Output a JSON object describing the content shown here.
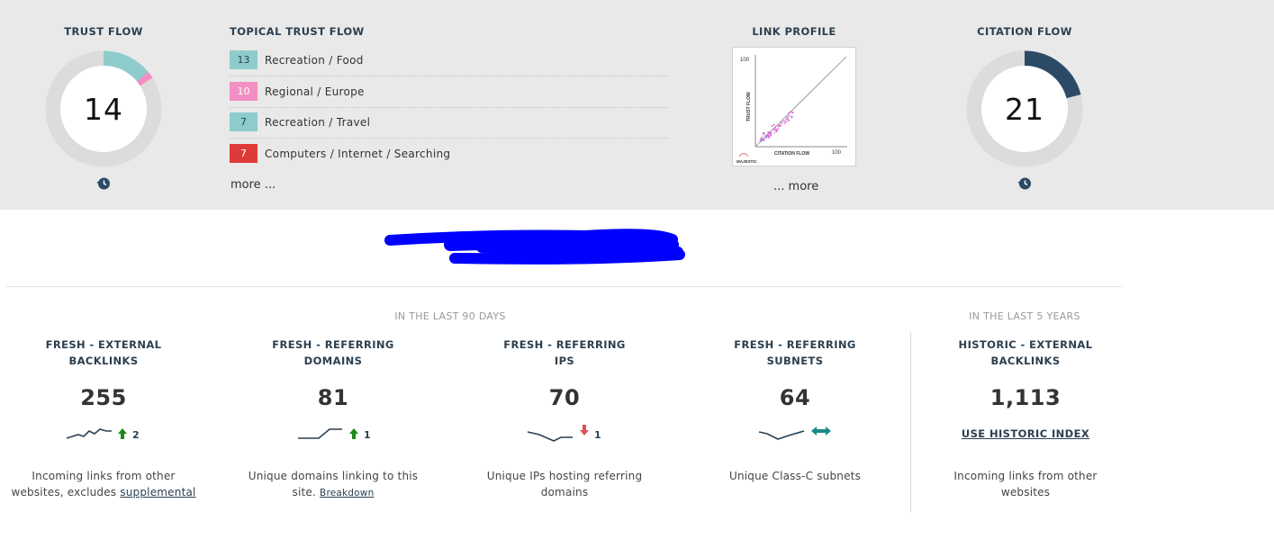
{
  "trust_flow": {
    "title": "TRUST FLOW",
    "value": "14",
    "fill_fraction": 0.14,
    "accent_fraction": 0.02
  },
  "topical_trust_flow": {
    "title": "TOPICAL TRUST FLOW",
    "items": [
      {
        "score": "13",
        "label": "Recreation / Food",
        "color": "#8ecccc"
      },
      {
        "score": "10",
        "label": "Regional / Europe",
        "color": "#f48fc3"
      },
      {
        "score": "7",
        "label": "Recreation / Travel",
        "color": "#8ecccc"
      },
      {
        "score": "7",
        "label": "Computers / Internet / Searching",
        "color": "#de3a3a"
      }
    ],
    "more": "more ..."
  },
  "link_profile": {
    "title": "LINK PROFILE",
    "y_axis_label": "TRUST FLOW",
    "x_axis_label": "CITATION FLOW",
    "y_max_label": "100",
    "x_max_label": "100",
    "brand": "MAJESTIC",
    "more": "... more"
  },
  "citation_flow": {
    "title": "CITATION FLOW",
    "value": "21",
    "fill_fraction": 0.21
  },
  "periods": {
    "recent": "IN THE LAST 90 DAYS",
    "historic": "IN THE LAST 5 YEARS"
  },
  "stats": [
    {
      "title_line1": "FRESH - EXTERNAL",
      "title_line2": "BACKLINKS",
      "value": "255",
      "change": "2",
      "direction": "up",
      "desc_line1": "Incoming links from other",
      "desc_line2": "websites, excludes ",
      "desc_link": "supplemental"
    },
    {
      "title_line1": "FRESH - REFERRING",
      "title_line2": "DOMAINS",
      "value": "81",
      "change": "1",
      "direction": "up",
      "desc_line1": "Unique domains linking to this",
      "desc_line2": "site. ",
      "desc_link": "Breakdown"
    },
    {
      "title_line1": "FRESH - REFERRING",
      "title_line2": "IPS",
      "value": "70",
      "change": "1",
      "direction": "down",
      "desc_line1": "Unique IPs hosting referring",
      "desc_line2": "domains",
      "desc_link": ""
    },
    {
      "title_line1": "FRESH - REFERRING",
      "title_line2": "SUBNETS",
      "value": "64",
      "change": "",
      "direction": "flat",
      "desc_line1": "Unique Class-C subnets",
      "desc_line2": "",
      "desc_link": ""
    }
  ],
  "historic": {
    "title_line1": "HISTORIC - EXTERNAL",
    "title_line2": "BACKLINKS",
    "value": "1,113",
    "link": "USE HISTORIC INDEX",
    "desc_line1": "Incoming links from other",
    "desc_line2": "websites"
  },
  "colors": {
    "teal": "#8ecccc",
    "pink": "#f48fc3",
    "red": "#de3a3a",
    "navy": "#2b4a66",
    "up_arrow": "#1a8a1a",
    "down_arrow": "#e0505a",
    "flat_arrow": "#1a8a8a"
  }
}
